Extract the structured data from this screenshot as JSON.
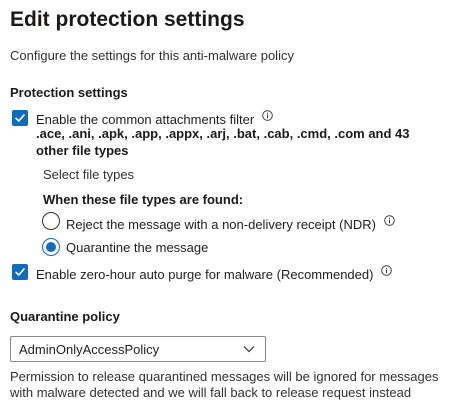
{
  "page": {
    "title": "Edit protection settings",
    "description": "Configure the settings for this anti-malware policy"
  },
  "protection": {
    "heading": "Protection settings",
    "attachments_filter": {
      "label": "Enable the common attachments filter",
      "checked": true,
      "file_types": ".ace, .ani, .apk, .app, .appx, .arj, .bat, .cab, .cmd, .com and 43 other file types"
    },
    "select_file_types": "Select file types",
    "when_found": {
      "label": "When these file types are found:",
      "options": [
        {
          "label": "Reject the message with a non-delivery receipt (NDR)",
          "selected": false
        },
        {
          "label": "Quarantine the message",
          "selected": true
        }
      ]
    },
    "zap": {
      "label": "Enable zero-hour auto purge for malware (Recommended)",
      "checked": true
    }
  },
  "quarantine": {
    "heading": "Quarantine policy",
    "selected": "AdminOnlyAccessPolicy",
    "note": "Permission to release quarantined messages will be ignored for messages with malware detected and we will fall back to release request instead"
  },
  "colors": {
    "accent": "#0f6cbd",
    "text": "#201f1e"
  }
}
